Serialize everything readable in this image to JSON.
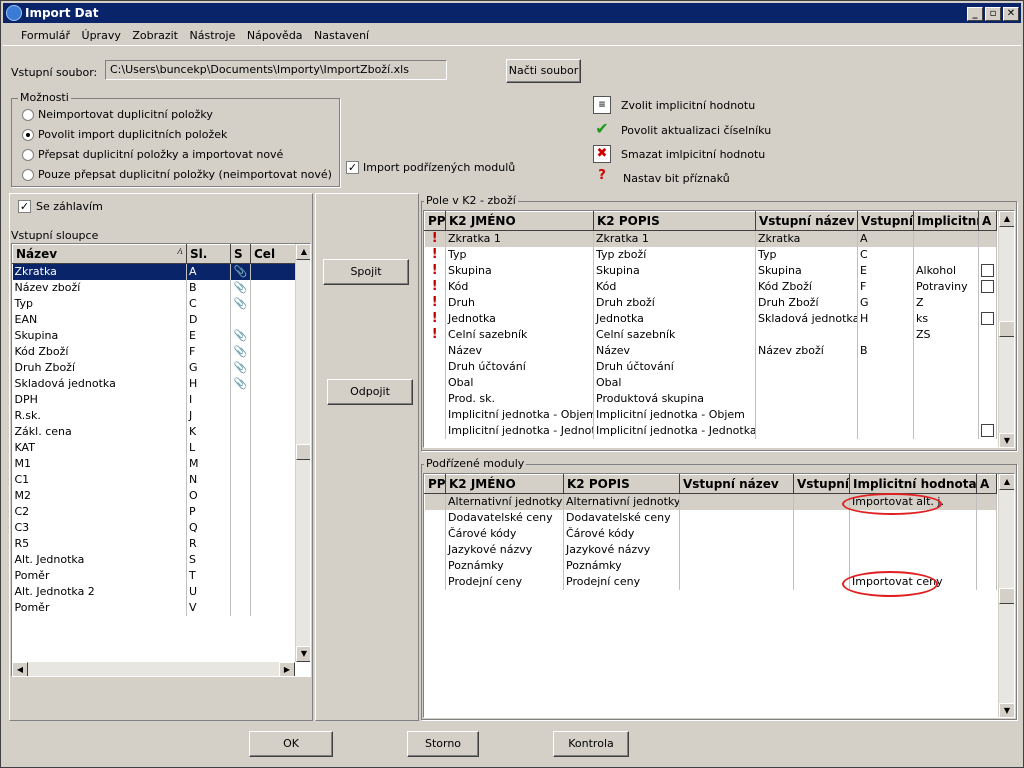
{
  "window": {
    "title": "Import Dat",
    "min": "_",
    "max": "▫",
    "close": "✕"
  },
  "menu": [
    "Formulář",
    "Úpravy",
    "Zobrazit",
    "Nástroje",
    "Nápověda",
    "Nastavení"
  ],
  "file": {
    "label": "Vstupní soubor:",
    "value": "C:\\Users\\buncekp\\Documents\\Importy\\ImportZboží.xls",
    "load_button": "Načti soubor"
  },
  "options": {
    "title": "Možnosti",
    "items": [
      "Neimportovat duplicitní položky",
      "Povolit import duplicitních položek",
      "Přepsat duplicitní položky a importovat nové",
      "Pouze přepsat duplicitní položky (neimportovat nové)"
    ],
    "selected_index": 1
  },
  "import_sub": {
    "label": "Import podřízených modulů",
    "checked": true
  },
  "actions": [
    {
      "label": "Zvolit implicitní hodnotu",
      "icon": "document-icon"
    },
    {
      "label": "Povolit aktualizaci číselníku",
      "icon": "checkmark-icon",
      "color": "#1a9a1a"
    },
    {
      "label": "Smazat imlpicitní hodnotu",
      "icon": "red-x-icon",
      "color": "#d00000"
    },
    {
      "label": "Nastav bit příznaků",
      "icon": "question-icon",
      "color": "#d00000"
    }
  ],
  "header_check": {
    "label": "Se záhlavím",
    "checked": true
  },
  "input_cols": {
    "title": "Vstupní sloupce",
    "headers": [
      "Název",
      "Sl.",
      "S",
      "Cel"
    ],
    "rows": [
      [
        "Zkratka",
        "A",
        "📎"
      ],
      [
        "Název zboží",
        "B",
        "📎"
      ],
      [
        "Typ",
        "C",
        "📎"
      ],
      [
        "EAN",
        "D",
        ""
      ],
      [
        "Skupina",
        "E",
        "📎"
      ],
      [
        "Kód Zboží",
        "F",
        "📎"
      ],
      [
        "Druh Zboží",
        "G",
        "📎"
      ],
      [
        "Skladová jednotka",
        "H",
        "📎"
      ],
      [
        "DPH",
        "I",
        ""
      ],
      [
        "R.sk.",
        "J",
        ""
      ],
      [
        "Zákl. cena",
        "K",
        ""
      ],
      [
        "KAT",
        "L",
        ""
      ],
      [
        "M1",
        "M",
        ""
      ],
      [
        "C1",
        "N",
        ""
      ],
      [
        "M2",
        "O",
        ""
      ],
      [
        "C2",
        "P",
        ""
      ],
      [
        "C3",
        "Q",
        ""
      ],
      [
        "R5",
        "R",
        ""
      ],
      [
        "Alt. Jednotka",
        "S",
        ""
      ],
      [
        "Poměr",
        "T",
        ""
      ],
      [
        "Alt. Jednotka 2",
        "U",
        ""
      ],
      [
        "Poměr",
        "V",
        ""
      ]
    ],
    "selected_row": 0
  },
  "mid_buttons": {
    "join": "Spojit",
    "unjoin": "Odpojit"
  },
  "k2_fields": {
    "title": "Pole v K2 - zboží",
    "headers": [
      "PP",
      "K2 JMÉNO",
      "K2 POPIS",
      "Vstupní název",
      "Vstupní",
      "Implicitní",
      "A"
    ],
    "rows": [
      [
        "!",
        "Zkratka 1",
        "Zkratka 1",
        "Zkratka",
        "A",
        "",
        ""
      ],
      [
        "!",
        "Typ",
        "Typ zboží",
        "Typ",
        "C",
        "",
        ""
      ],
      [
        "!",
        "Skupina",
        "Skupina",
        "Skupina",
        "E",
        "Alkohol",
        "box"
      ],
      [
        "!",
        "Kód",
        "Kód",
        "Kód Zboží",
        "F",
        "Potraviny",
        "box"
      ],
      [
        "!",
        "Druh",
        "Druh zboží",
        "Druh Zboží",
        "G",
        "Z",
        ""
      ],
      [
        "!",
        "Jednotka",
        "Jednotka",
        "Skladová jednotka",
        "H",
        "ks",
        "box"
      ],
      [
        "!",
        "Celní sazebník",
        "Celní sazebník",
        "",
        "",
        "ZS",
        ""
      ],
      [
        "",
        "Název",
        "Název",
        "Název zboží",
        "B",
        "",
        ""
      ],
      [
        "",
        "Druh účtování",
        "Druh účtování",
        "",
        "",
        "",
        ""
      ],
      [
        "",
        "Obal",
        "Obal",
        "",
        "",
        "",
        ""
      ],
      [
        "",
        "Prod. sk.",
        "Produktová skupina",
        "",
        "",
        "",
        ""
      ],
      [
        "",
        "Implicitní jednotka - Objem",
        "Implicitní jednotka - Objem",
        "",
        "",
        "",
        ""
      ],
      [
        "",
        "Implicitní jednotka - Jednot...",
        "Implicitní jednotka - Jednotka ...",
        "",
        "",
        "",
        "box"
      ]
    ]
  },
  "sub_modules": {
    "title": "Podřízené moduly",
    "headers": [
      "PP",
      "K2 JMÉNO",
      "K2 POPIS",
      "Vstupní název",
      "Vstupní",
      "Implicitní hodnota",
      "A"
    ],
    "rows": [
      [
        "",
        "Alternativní jednotky",
        "Alternativní jednotky",
        "",
        "",
        "Importovat alt. j.",
        ""
      ],
      [
        "",
        "Dodavatelské ceny",
        "Dodavatelské ceny",
        "",
        "",
        "",
        ""
      ],
      [
        "",
        "Čárové kódy",
        "Čárové kódy",
        "",
        "",
        "",
        ""
      ],
      [
        "",
        "Jazykové názvy",
        "Jazykové názvy",
        "",
        "",
        "",
        ""
      ],
      [
        "",
        "Poznámky",
        "Poznámky",
        "",
        "",
        "",
        ""
      ],
      [
        "",
        "Prodejní ceny",
        "Prodejní ceny",
        "",
        "",
        "Importovat ceny",
        ""
      ]
    ]
  },
  "footer": {
    "ok": "OK",
    "cancel": "Storno",
    "check": "Kontrola"
  }
}
